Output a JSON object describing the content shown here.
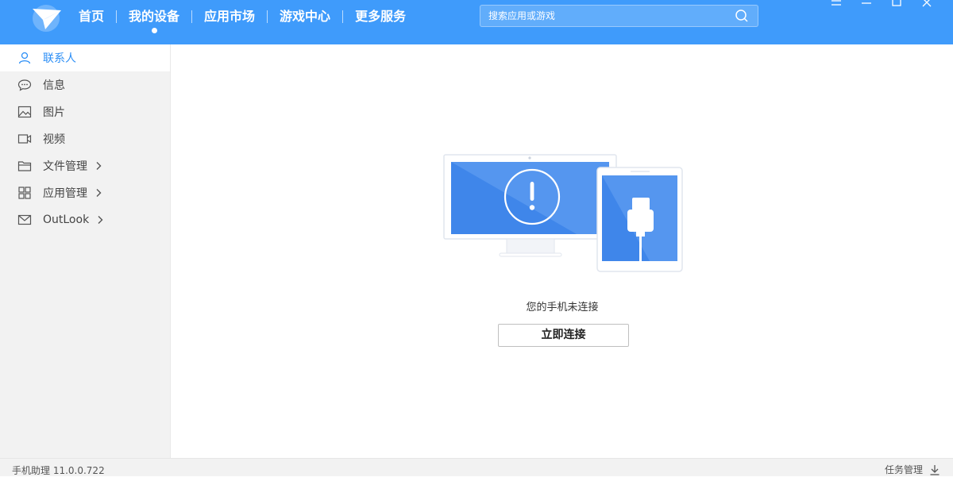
{
  "header": {
    "nav": [
      {
        "label": "首页"
      },
      {
        "label": "我的设备"
      },
      {
        "label": "应用市场"
      },
      {
        "label": "游戏中心"
      },
      {
        "label": "更多服务"
      }
    ],
    "active_nav": "我的设备",
    "search": {
      "placeholder": "搜索应用或游戏"
    },
    "colors": {
      "brand": "#3f9bfb",
      "accent": "#2b8ef6"
    }
  },
  "sidebar": {
    "items": [
      {
        "label": "联系人",
        "icon": "person-icon"
      },
      {
        "label": "信息",
        "icon": "chat-bubble-icon"
      },
      {
        "label": "图片",
        "icon": "image-icon"
      },
      {
        "label": "视频",
        "icon": "video-camera-icon"
      },
      {
        "label": "文件管理",
        "icon": "folder-icon",
        "has_submenu": true
      },
      {
        "label": "应用管理",
        "icon": "grid-apps-icon",
        "has_submenu": true
      },
      {
        "label": "OutLook",
        "icon": "mail-icon",
        "has_submenu": true
      }
    ],
    "active_item": "联系人"
  },
  "main": {
    "status_text": "您的手机未连接",
    "connect_button": "立即连接"
  },
  "footer": {
    "version": "手机助理 11.0.0.722",
    "task_manager": "任务管理"
  }
}
